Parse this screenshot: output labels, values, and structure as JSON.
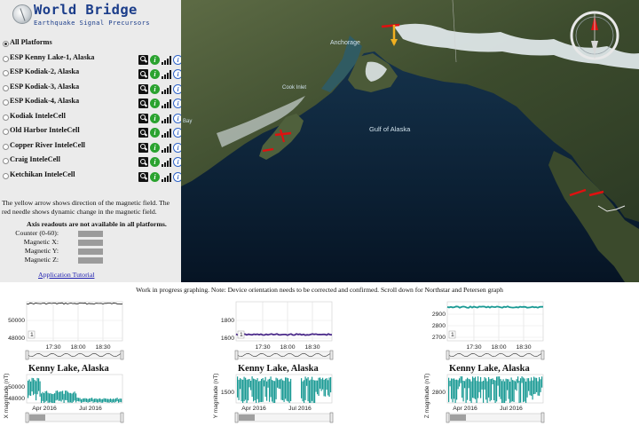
{
  "app": {
    "title": "World Bridge",
    "subtitle": "Earthquake Signal Precursors"
  },
  "platforms": [
    {
      "label": "All Platforms",
      "selected": true,
      "has_icons": false
    },
    {
      "label": "ESP Kenny Lake-1, Alaska",
      "selected": false,
      "has_icons": true
    },
    {
      "label": "ESP Kodiak-2, Alaska",
      "selected": false,
      "has_icons": true
    },
    {
      "label": "ESP Kodiak-3, Alaska",
      "selected": false,
      "has_icons": true
    },
    {
      "label": "ESP Kodiak-4, Alaska",
      "selected": false,
      "has_icons": true
    },
    {
      "label": "Kodiak InteleCell",
      "selected": false,
      "has_icons": true
    },
    {
      "label": "Old Harbor InteleCell",
      "selected": false,
      "has_icons": true
    },
    {
      "label": "Copper River InteleCell",
      "selected": false,
      "has_icons": true
    },
    {
      "label": "Craig InteleCell",
      "selected": false,
      "has_icons": true
    },
    {
      "label": "Ketchikan InteleCell",
      "selected": false,
      "has_icons": true
    }
  ],
  "platform_icons": [
    "search-icon",
    "info-green-icon",
    "signal-strength-icon",
    "info-blue-icon"
  ],
  "legend": {
    "text": "The yellow arrow shows direction of the magnetic field. The red needle shows dynamic change in the magnetic field.",
    "axis_heading": "Axis readouts are not available in all platforms.",
    "readouts": [
      {
        "label": "Counter (0-60):",
        "value": ""
      },
      {
        "label": "Magnetic X:",
        "value": ""
      },
      {
        "label": "Magnetic Y:",
        "value": ""
      },
      {
        "label": "Magnetic Z:",
        "value": ""
      }
    ],
    "tutorial_link": "Application Tutorial"
  },
  "map": {
    "labels": {
      "anchorage": "Anchorage",
      "cook_inlet": "Cook Inlet",
      "bristol": "Bay",
      "gulf": "Gulf of Alaska"
    },
    "colors": {
      "ocean": "#0b2236",
      "land": "#3a4b2c",
      "snow": "#e8eef2",
      "needle": "#e01010",
      "arrow": "#f0c020"
    },
    "compass_icon": "compass-rose-icon"
  },
  "note": "Work in progress graphing. Note: Device orientation needs to be corrected and confirmed. Scroll down for Northstar and Petersen graph",
  "chart_data": [
    {
      "type": "line",
      "title": "Kenny Lake, Alaska",
      "detail": {
        "yticks": [
          "50000",
          "48000"
        ],
        "xticks": [
          "17:30",
          "18:00",
          "18:30"
        ],
        "line_color": "#111111",
        "value_note": "flat near top of range",
        "nav_marker": "1"
      },
      "overview": {
        "ylabel": "X magnitude (nT)",
        "yticks": [
          "50000",
          "48000"
        ],
        "xticks": [
          "Apr 2016",
          "Jul 2016"
        ],
        "color": "#1a9a94"
      }
    },
    {
      "type": "line",
      "title": "Kenny Lake, Alaska",
      "detail": {
        "yticks": [
          "1800",
          "1600"
        ],
        "xticks": [
          "17:30",
          "18:00",
          "18:30"
        ],
        "line_color": "#4b2a8a",
        "value_approx": 1605,
        "nav_marker": "1"
      },
      "overview": {
        "ylabel": "Y magnitude (nT)",
        "yticks": [
          "1500"
        ],
        "xticks": [
          "Apr 2016",
          "Jul 2016"
        ],
        "color": "#1a9a94"
      }
    },
    {
      "type": "line",
      "title": "Kenny Lake, Alaska",
      "detail": {
        "yticks": [
          "2900",
          "2800",
          "2700"
        ],
        "xticks": [
          "17:30",
          "18:00",
          "18:30"
        ],
        "line_color": "#1a9a94",
        "value_approx": 2965,
        "nav_marker": "1"
      },
      "overview": {
        "ylabel": "Z magnitude (nT)",
        "yticks": [
          "2800"
        ],
        "xticks": [
          "Apr 2016",
          "Jul 2016"
        ],
        "color": "#1a9a94"
      }
    }
  ]
}
